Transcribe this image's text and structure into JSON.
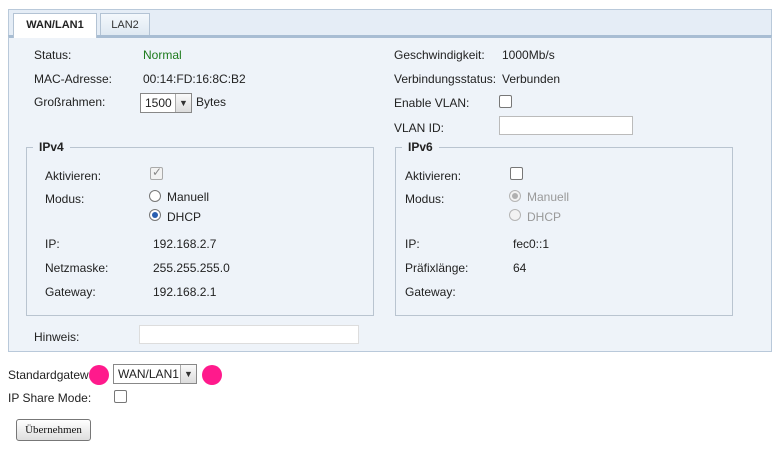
{
  "tabs": [
    {
      "label": "WAN/LAN1",
      "active": true
    },
    {
      "label": "LAN2",
      "active": false
    }
  ],
  "left": {
    "status_label": "Status:",
    "status_value": "Normal",
    "status_color": "#1c7a1c",
    "mac_label": "MAC-Adresse:",
    "mac_value": "00:14:FD:16:8C:B2",
    "jumbo_label": "Großrahmen:",
    "jumbo_value": "1500",
    "jumbo_unit": "Bytes"
  },
  "right": {
    "speed_label": "Geschwindigkeit:",
    "speed_value": "1000Mb/s",
    "link_label": "Verbindungsstatus:",
    "link_value": "Verbunden",
    "vlan_enable_label": "Enable VLAN:",
    "vlan_enabled": false,
    "vlan_id_label": "VLAN ID:",
    "vlan_id_value": ""
  },
  "ipv4": {
    "legend": "IPv4",
    "activate_label": "Aktivieren:",
    "activate_checked": true,
    "mode_label": "Modus:",
    "mode_options": [
      "Manuell",
      "DHCP"
    ],
    "mode_selected": "DHCP",
    "ip_label": "IP:",
    "ip_value": "192.168.2.7",
    "netmask_label": "Netzmaske:",
    "netmask_value": "255.255.255.0",
    "gateway_label": "Gateway:",
    "gateway_value": "192.168.2.1"
  },
  "ipv6": {
    "legend": "IPv6",
    "activate_label": "Aktivieren:",
    "activate_checked": false,
    "mode_label": "Modus:",
    "mode_options": [
      "Manuell",
      "DHCP"
    ],
    "mode_selected": "Manuell",
    "ip_label": "IP:",
    "ip_value": "fec0::1",
    "prefix_label": "Präfixlänge:",
    "prefix_value": "64",
    "gateway_label": "Gateway:",
    "gateway_value": ""
  },
  "note": {
    "label": "Hinweis:",
    "value": ""
  },
  "bottom": {
    "gateway_label": "Standardgatewa",
    "gateway_value": "WAN/LAN1",
    "ip_share_label": "IP Share Mode:",
    "ip_share_checked": false,
    "apply_label": "Übernehmen"
  },
  "markers_color": "#ff1a8c"
}
